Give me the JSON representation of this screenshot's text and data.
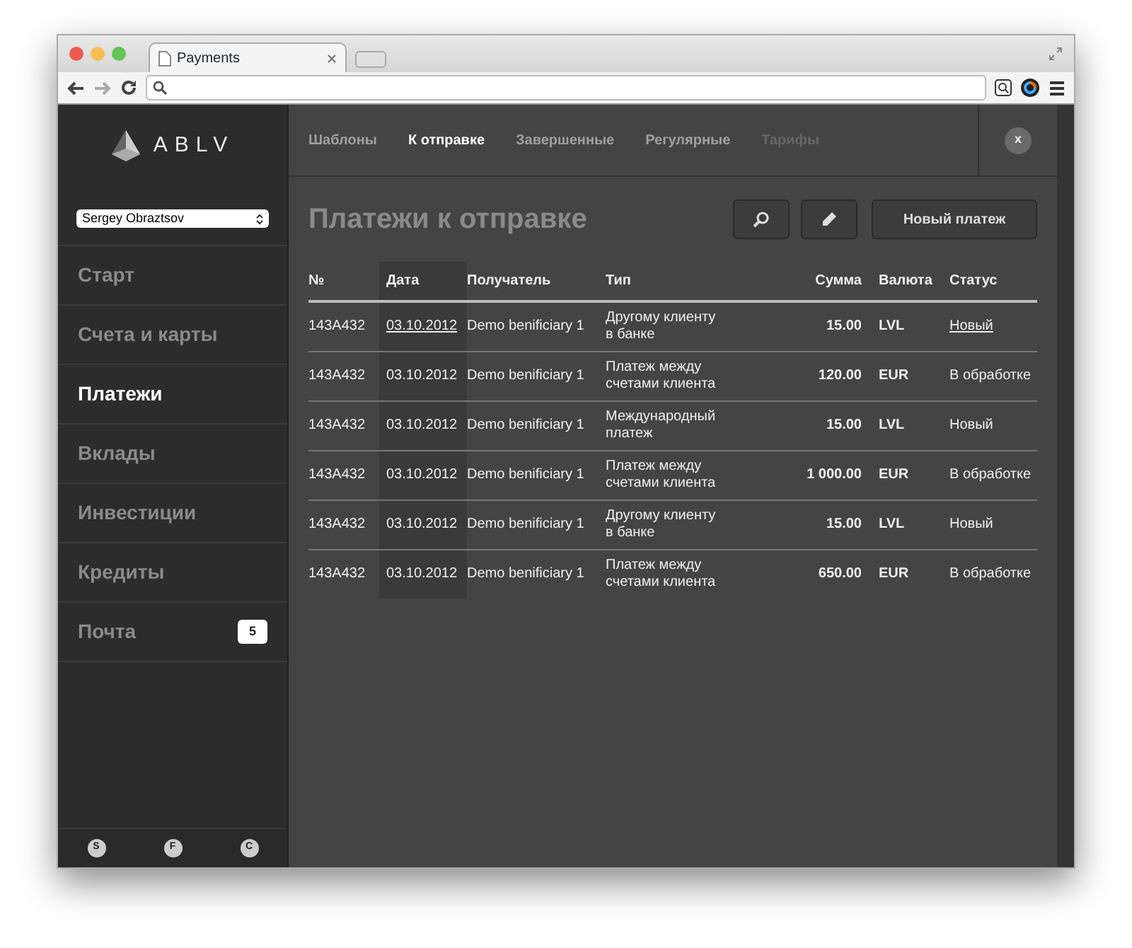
{
  "browser": {
    "tab_title": "Payments"
  },
  "sidebar": {
    "logo": "ABLV",
    "user_select": "Sergey Obraztsov",
    "menu": [
      {
        "label": "Старт",
        "selected": false
      },
      {
        "label": "Счета и карты",
        "selected": false
      },
      {
        "label": "Платежи",
        "selected": true
      },
      {
        "label": "Вклады",
        "selected": false
      },
      {
        "label": "Инвестиции",
        "selected": false
      },
      {
        "label": "Кредиты",
        "selected": false
      },
      {
        "label": "Почта",
        "selected": false,
        "badge": "5"
      }
    ],
    "footer_buttons": [
      "S",
      "F",
      "C"
    ]
  },
  "tabs": [
    {
      "label": "Шаблоны",
      "selected": false,
      "disabled": false
    },
    {
      "label": "К отправке",
      "selected": true,
      "disabled": false
    },
    {
      "label": "Завершенные",
      "selected": false,
      "disabled": false
    },
    {
      "label": "Регулярные",
      "selected": false,
      "disabled": false
    },
    {
      "label": "Тарифы",
      "selected": false,
      "disabled": true
    }
  ],
  "close_button": "x",
  "heading": "Платежи к отправке",
  "new_payment_button": "Новый платеж",
  "table": {
    "columns": [
      {
        "label": "№",
        "kind": "text",
        "sorted": false
      },
      {
        "label": "Дата",
        "kind": "text",
        "sorted": true
      },
      {
        "label": "Получатель",
        "kind": "text",
        "sorted": false
      },
      {
        "label": "Тип",
        "kind": "text",
        "sorted": false
      },
      {
        "label": "Сумма",
        "kind": "amount",
        "sorted": false
      },
      {
        "label": "Валюта",
        "kind": "code",
        "sorted": false
      },
      {
        "label": "Статус",
        "kind": "text",
        "sorted": false
      }
    ],
    "rows": [
      {
        "cells": [
          "143A432",
          "03.10.2012",
          "Demo benificiary 1",
          "Другому клиенту в банке",
          "15.00",
          "LVL",
          "Новый"
        ],
        "linked": true
      },
      {
        "cells": [
          "143A432",
          "03.10.2012",
          "Demo benificiary 1",
          "Платеж между счетами клиента",
          "120.00",
          "EUR",
          "В обработке"
        ],
        "linked": false
      },
      {
        "cells": [
          "143A432",
          "03.10.2012",
          "Demo benificiary 1",
          "Международный платеж",
          "15.00",
          "LVL",
          "Новый"
        ],
        "linked": false
      },
      {
        "cells": [
          "143A432",
          "03.10.2012",
          "Demo benificiary 1",
          "Платеж между счетами клиента",
          "1 000.00",
          "EUR",
          "В обработке"
        ],
        "linked": false
      },
      {
        "cells": [
          "143A432",
          "03.10.2012",
          "Demo benificiary 1",
          "Другому клиенту в банке",
          "15.00",
          "LVL",
          "Новый"
        ],
        "linked": false
      },
      {
        "cells": [
          "143A432",
          "03.10.2012",
          "Demo benificiary 1",
          "Платеж между счетами клиента",
          "650.00",
          "EUR",
          "В обработке"
        ],
        "linked": false
      }
    ]
  }
}
